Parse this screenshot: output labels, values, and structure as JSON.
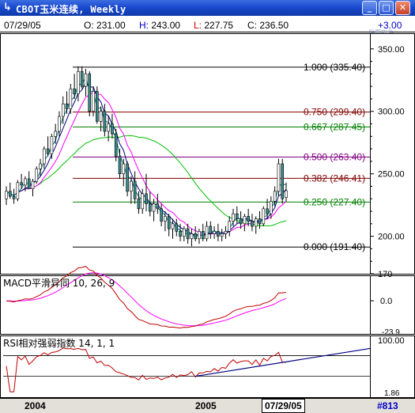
{
  "window": {
    "title": "CBOT玉米连续, Weekly",
    "app_icon": "chart-icon",
    "minimize": "_",
    "maximize": "□",
    "close": "✕"
  },
  "info": {
    "date": "07/29/05",
    "open_label": "O:",
    "open": "231.00",
    "high_label": "H:",
    "high": "243.00",
    "low_label": "L:",
    "low": "227.75",
    "close_label": "C:",
    "close": "236.50",
    "change": "+3.00",
    "watermark": "股票软件"
  },
  "colors": {
    "fib_black": "#000000",
    "fib_red": "#800000",
    "fib_green": "#008000",
    "fib_purple": "#800080",
    "candle_up": "#ffffff",
    "candle_down": "#3a8a8a",
    "ma_short": "#008080",
    "ma_mid": "#000080",
    "ma_long": "#ff00ff",
    "ma_longest": "#00c000",
    "macd": "#c00000",
    "signal": "#ff00ff",
    "rsi": "#c00000",
    "trendline": "#000080"
  },
  "price_panel": {
    "axis_labels": [
      "350.00",
      "300.00",
      "250.00",
      "200.00",
      "170"
    ],
    "fib_levels": [
      {
        "label": "1.000",
        "value": "(335.40)",
        "color": "#000000",
        "price": 335.4
      },
      {
        "label": "0.750",
        "value": "(299.40)",
        "color": "#800000",
        "price": 299.4
      },
      {
        "label": "0.667",
        "value": "(287.45)",
        "color": "#008000",
        "price": 287.45
      },
      {
        "label": "0.500",
        "value": "(263.40)",
        "color": "#800080",
        "price": 263.4
      },
      {
        "label": "0.382",
        "value": "(246.41)",
        "color": "#800000",
        "price": 246.41
      },
      {
        "label": "0.250",
        "value": "(227.40)",
        "color": "#008000",
        "price": 227.4
      },
      {
        "label": "0.000",
        "value": "(191.40)",
        "color": "#000000",
        "price": 191.4
      }
    ]
  },
  "macd_panel": {
    "title": "MACD平滑异同",
    "params": "10, 26, 9",
    "axis_labels": [
      "0.0",
      "-23.9"
    ]
  },
  "rsi_panel": {
    "title": "RSI相对强弱指数",
    "params": "14, 1, 1",
    "axis_labels": [
      "100.00",
      "1.86"
    ]
  },
  "status": {
    "year_2004": "2004",
    "year_2005": "2005",
    "cursor_date": "07/29/05",
    "count": "#813"
  },
  "chart_data": {
    "type": "candlestick",
    "title": "CBOT玉米连续, Weekly",
    "x_range": [
      "2003-07",
      "2005-07-29"
    ],
    "y_range": [
      170,
      360
    ],
    "ohlc": [
      [
        230,
        240,
        225,
        236
      ],
      [
        236,
        243,
        230,
        232
      ],
      [
        232,
        238,
        226,
        230
      ],
      [
        230,
        245,
        228,
        243
      ],
      [
        243,
        250,
        238,
        241
      ],
      [
        241,
        248,
        236,
        246
      ],
      [
        246,
        252,
        240,
        238
      ],
      [
        238,
        246,
        232,
        244
      ],
      [
        244,
        256,
        242,
        254
      ],
      [
        254,
        262,
        248,
        258
      ],
      [
        258,
        272,
        254,
        270
      ],
      [
        270,
        280,
        264,
        266
      ],
      [
        266,
        282,
        262,
        280
      ],
      [
        280,
        290,
        274,
        284
      ],
      [
        284,
        300,
        280,
        296
      ],
      [
        296,
        312,
        290,
        306
      ],
      [
        306,
        316,
        298,
        302
      ],
      [
        302,
        322,
        298,
        318
      ],
      [
        318,
        330,
        310,
        314
      ],
      [
        314,
        336,
        308,
        332
      ],
      [
        332,
        336,
        318,
        320
      ],
      [
        320,
        334,
        312,
        330
      ],
      [
        330,
        332,
        296,
        300
      ],
      [
        300,
        320,
        296,
        316
      ],
      [
        316,
        320,
        290,
        292
      ],
      [
        292,
        304,
        284,
        300
      ],
      [
        300,
        306,
        280,
        284
      ],
      [
        284,
        296,
        276,
        290
      ],
      [
        290,
        298,
        278,
        282
      ],
      [
        282,
        286,
        260,
        264
      ],
      [
        264,
        270,
        246,
        250
      ],
      [
        250,
        262,
        240,
        258
      ],
      [
        258,
        260,
        232,
        236
      ],
      [
        236,
        248,
        226,
        244
      ],
      [
        244,
        252,
        226,
        230
      ],
      [
        230,
        236,
        218,
        222
      ],
      [
        222,
        238,
        218,
        234
      ],
      [
        234,
        250,
        220,
        226
      ],
      [
        226,
        236,
        216,
        220
      ],
      [
        220,
        230,
        212,
        226
      ],
      [
        226,
        234,
        218,
        222
      ],
      [
        222,
        226,
        208,
        212
      ],
      [
        212,
        220,
        204,
        216
      ],
      [
        216,
        218,
        200,
        206
      ],
      [
        206,
        214,
        198,
        210
      ],
      [
        210,
        214,
        200,
        204
      ],
      [
        204,
        210,
        196,
        200
      ],
      [
        200,
        208,
        196,
        206
      ],
      [
        206,
        210,
        194,
        198
      ],
      [
        198,
        206,
        192,
        202
      ],
      [
        202,
        208,
        196,
        198
      ],
      [
        198,
        206,
        194,
        204
      ],
      [
        204,
        210,
        196,
        198
      ],
      [
        198,
        212,
        196,
        208
      ],
      [
        208,
        212,
        198,
        202
      ],
      [
        202,
        208,
        198,
        204
      ],
      [
        204,
        210,
        196,
        200
      ],
      [
        200,
        206,
        196,
        202
      ],
      [
        202,
        208,
        198,
        204
      ],
      [
        204,
        216,
        200,
        212
      ],
      [
        212,
        222,
        208,
        218
      ],
      [
        218,
        224,
        210,
        214
      ],
      [
        214,
        220,
        206,
        210
      ],
      [
        210,
        218,
        204,
        216
      ],
      [
        216,
        222,
        208,
        212
      ],
      [
        212,
        218,
        204,
        208
      ],
      [
        208,
        216,
        202,
        214
      ],
      [
        214,
        220,
        206,
        210
      ],
      [
        210,
        224,
        208,
        222
      ],
      [
        222,
        230,
        214,
        218
      ],
      [
        218,
        232,
        214,
        228
      ],
      [
        228,
        240,
        224,
        236
      ],
      [
        236,
        262,
        232,
        258
      ],
      [
        258,
        262,
        226,
        230
      ],
      [
        231,
        243,
        227.75,
        236.5
      ]
    ],
    "fib_retracement": {
      "high": 335.4,
      "low": 191.4
    },
    "macd": {
      "fast": 10,
      "slow": 26,
      "signal": 9,
      "ylim": [
        -23.9,
        14
      ]
    },
    "rsi": {
      "period": 14,
      "ylim": [
        1.86,
        100
      ]
    }
  }
}
